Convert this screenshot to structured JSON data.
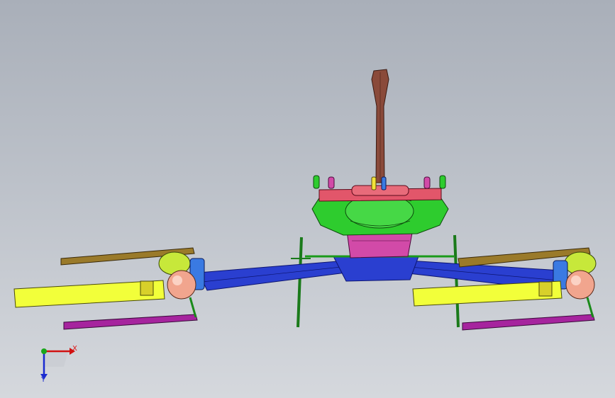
{
  "viewport": {
    "background_top": "#a9afb9",
    "background_bottom": "#d5d8dd"
  },
  "triad": {
    "x_label": "X",
    "y_label": "Y",
    "x_color": "#d11111",
    "y_color": "#1a2bd0",
    "origin_color": "#1aa61a"
  },
  "model": {
    "icon": "quadcopter-assembly",
    "part_colors": {
      "mast": "#8a4a3a",
      "body": "#2ecc2e",
      "hub": "#d24aa8",
      "arms": "#2a3fd0",
      "front_beams": "#f2ff3a",
      "rear_beams": "#a6249e",
      "props": "#9a7a2a",
      "pods": "#f1a58e",
      "legs": "#1a8a1a"
    }
  }
}
